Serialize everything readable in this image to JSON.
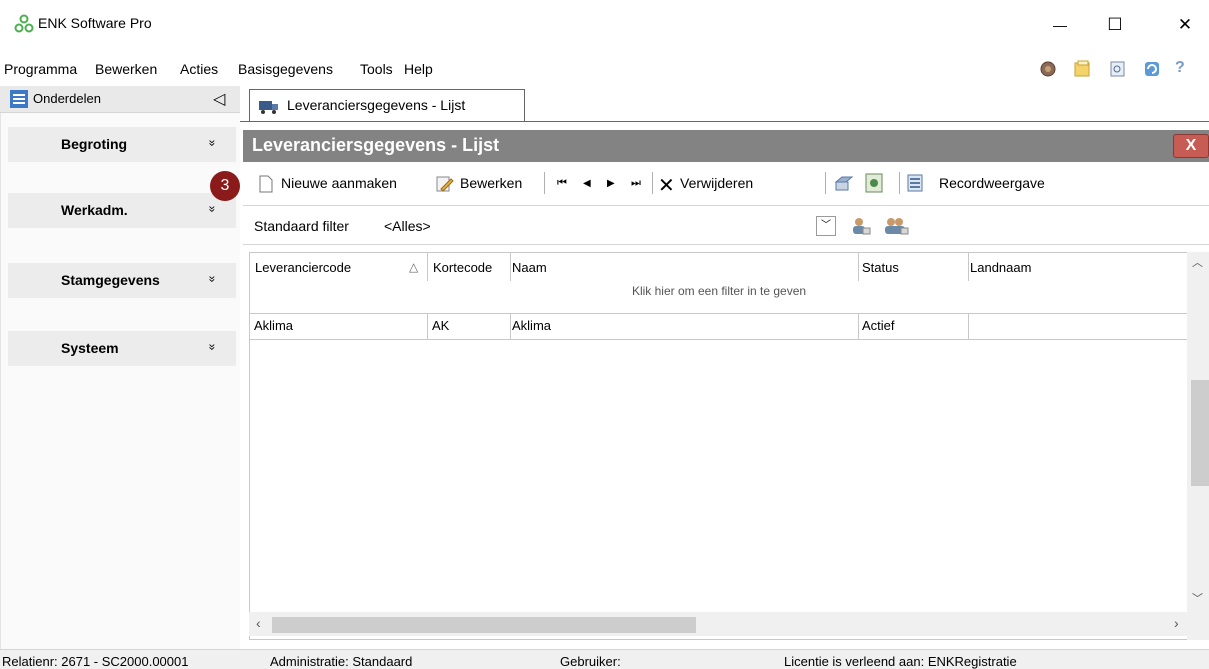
{
  "window": {
    "title": "ENK Software Pro",
    "minimize": "—",
    "maximize": "☐",
    "close": "✕"
  },
  "menu": [
    "Programma",
    "Bewerken",
    "Acties",
    "Basisgegevens",
    "Tools",
    "Help"
  ],
  "quick_icons": [
    "globe-icon",
    "folder-icon",
    "search-report-icon",
    "refresh-icon",
    "help-icon"
  ],
  "nav": {
    "header": "Onderdelen",
    "collapse": "◁",
    "sections": [
      {
        "label": "Begroting",
        "chevron": "»"
      },
      {
        "label": "Werkadm.",
        "chevron": "»"
      },
      {
        "label": "Stamgegevens",
        "chevron": "»"
      },
      {
        "label": "Systeem",
        "chevron": "»"
      }
    ]
  },
  "tab": {
    "label": "Leveranciersgegevens - Lijst"
  },
  "panel": {
    "title": "Leveranciersgegevens - Lijst",
    "close": "X"
  },
  "badge": "3",
  "toolbar": {
    "new": "Nieuwe aanmaken",
    "edit": "Bewerken",
    "first": "⏮",
    "prev": "◀",
    "next": "▶",
    "last": "⏭",
    "delete": "Verwijderen",
    "record_view": "Recordweergave"
  },
  "filter": {
    "label": "Standaard filter",
    "value": "<Alles>"
  },
  "grid": {
    "columns": [
      "Leveranciercode",
      "Kortecode",
      "Naam",
      "Status",
      "Landnaam"
    ],
    "sort_indicator": "△",
    "filter_hint": "Klik hier om een filter in te geven",
    "rows": [
      [
        "Aklima",
        "AK",
        "Aklima",
        "Actief",
        ""
      ]
    ]
  },
  "status": {
    "relation": "Relatienr: 2671 - SC2000.00001",
    "administration": "Administratie: Standaard",
    "user": "Gebruiker:",
    "license": "Licentie is verleend aan: ENKRegistratie"
  },
  "colors": {
    "panel_title_bg": "#838383",
    "badge_bg": "#8b1a1a",
    "close_red": "#c65c53",
    "nav_icon_blue": "#3c78c8",
    "app_icon_green": "#4caf50"
  }
}
